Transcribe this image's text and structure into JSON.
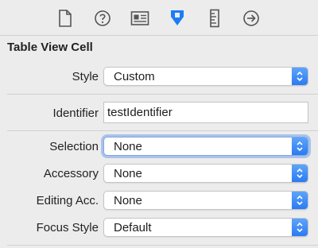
{
  "toolbar": {
    "icons": [
      "file-icon",
      "help-icon",
      "identity-icon",
      "attributes-icon",
      "size-icon",
      "connections-icon"
    ],
    "accent": "#1b7cf6"
  },
  "section": {
    "title": "Table View Cell"
  },
  "fields": {
    "style": {
      "label": "Style",
      "value": "Custom"
    },
    "identifier": {
      "label": "Identifier",
      "value": "testIdentifier"
    },
    "selection": {
      "label": "Selection",
      "value": "None"
    },
    "accessory": {
      "label": "Accessory",
      "value": "None"
    },
    "editing_accessory": {
      "label": "Editing Acc.",
      "value": "None"
    },
    "focus_style": {
      "label": "Focus Style",
      "value": "Default"
    }
  }
}
